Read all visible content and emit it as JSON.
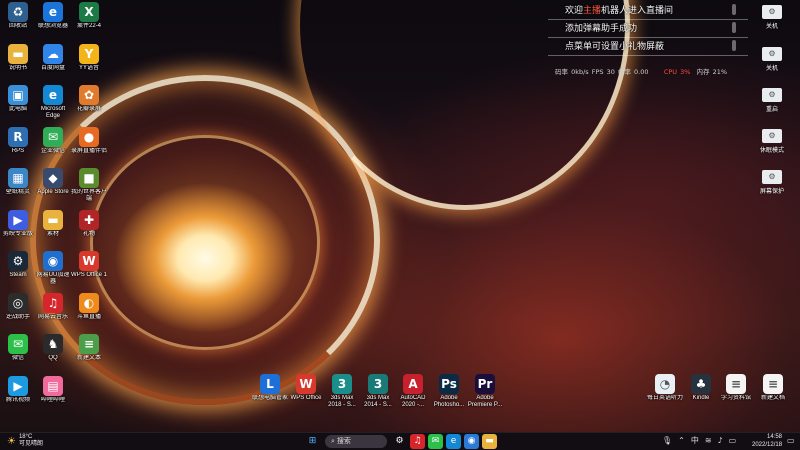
{
  "desktop_icons": [
    {
      "id": "recycle-bin",
      "label": "回收站",
      "icon": "recycle-icon",
      "glyph": "♻",
      "bg": "#2d5f8f"
    },
    {
      "id": "lenovo-browser",
      "label": "联想浏览器",
      "icon": "browser-icon",
      "glyph": "e",
      "bg": "#1a74d9"
    },
    {
      "id": "spreadsheet-file",
      "label": "案件22-4",
      "icon": "excel-file-icon",
      "glyph": "X",
      "bg": "#1d7a45"
    },
    {
      "id": "folder-a",
      "label": "说明书",
      "icon": "folder-icon",
      "glyph": "▬",
      "bg": "#e8b23c"
    },
    {
      "id": "baidu-netdisk",
      "label": "百度网盘",
      "icon": "cloud-icon",
      "glyph": "☁",
      "bg": "#2f86e8"
    },
    {
      "id": "yy-voice",
      "label": "YY语音",
      "icon": "yy-icon",
      "glyph": "Y",
      "bg": "#f2b418"
    },
    {
      "id": "this-pc",
      "label": "此电脑",
      "icon": "computer-icon",
      "glyph": "▣",
      "bg": "#3a8fd6"
    },
    {
      "id": "edge",
      "label": "Microsoft Edge",
      "icon": "edge-icon",
      "glyph": "e",
      "bg": "#1588d4"
    },
    {
      "id": "sakura-tool",
      "label": "花瓣录屏",
      "icon": "flower-app-icon",
      "glyph": "✿",
      "bg": "#e07a2d"
    },
    {
      "id": "rps",
      "label": "RPS",
      "icon": "rps-icon",
      "glyph": "R",
      "bg": "#2e6fb3"
    },
    {
      "id": "wechat-work",
      "label": "企业微信",
      "icon": "wecom-icon",
      "glyph": "✉",
      "bg": "#2fae57"
    },
    {
      "id": "record-tool",
      "label": "录屏直播伴侣",
      "icon": "camera-app-icon",
      "glyph": "●",
      "bg": "#e76a22"
    },
    {
      "id": "wallpaper-app",
      "label": "壁纸精灵",
      "icon": "wallpaper-icon",
      "glyph": "▦",
      "bg": "#3a86c7"
    },
    {
      "id": "apple-store",
      "label": "Apple Store",
      "icon": "apple-icon",
      "glyph": "◆",
      "bg": "#384a6e"
    },
    {
      "id": "minecraft",
      "label": "我的世界客户端",
      "icon": "grass-block-icon",
      "glyph": "■",
      "bg": "#5a8c2d"
    },
    {
      "id": "video-editor",
      "label": "剪映专业版",
      "icon": "video-editor-icon",
      "glyph": "▶",
      "bg": "#3f5de0"
    },
    {
      "id": "folder-b",
      "label": "素材",
      "icon": "folder-icon",
      "glyph": "▬",
      "bg": "#e8b23c"
    },
    {
      "id": "gift-app",
      "label": "礼物",
      "icon": "gift-icon",
      "glyph": "✚",
      "bg": "#b02626"
    },
    {
      "id": "steam",
      "label": "Steam",
      "icon": "steam-icon",
      "glyph": "⚙",
      "bg": "#1b2838"
    },
    {
      "id": "uu-accelerator",
      "label": "网易UU加速器",
      "icon": "accelerator-icon",
      "glyph": "◉",
      "bg": "#1f6fd1"
    },
    {
      "id": "wps-app",
      "label": "WPS Office 1",
      "icon": "wps-icon",
      "glyph": "W",
      "bg": "#d9382d"
    },
    {
      "id": "game-launcher",
      "label": "逆战助手",
      "icon": "game-icon",
      "glyph": "◎",
      "bg": "#2c2c2c"
    },
    {
      "id": "netease-music",
      "label": "网易云音乐",
      "icon": "music-icon",
      "glyph": "♫",
      "bg": "#d7262b"
    },
    {
      "id": "streaming-app",
      "label": "斗鱼直播",
      "icon": "fish-icon",
      "glyph": "◐",
      "bg": "#ef8b1b"
    },
    {
      "id": "wechat",
      "label": "微信",
      "icon": "wechat-icon",
      "glyph": "✉",
      "bg": "#2cbf4a"
    },
    {
      "id": "qq",
      "label": "QQ",
      "icon": "penguin-icon",
      "glyph": "♞",
      "bg": "#2a2a2a"
    },
    {
      "id": "text-file",
      "label": "新建文本",
      "icon": "text-file-icon",
      "glyph": "≡",
      "bg": "#4c9e4a"
    },
    {
      "id": "tencent-video",
      "label": "腾讯视频",
      "icon": "play-icon",
      "glyph": "▶",
      "bg": "#1e9ae0"
    },
    {
      "id": "bilibili-app",
      "label": "哔哩哔哩",
      "icon": "bilibili-icon",
      "glyph": "▤",
      "bg": "#f06a9c"
    }
  ],
  "bottom_icons": [
    {
      "id": "lenovo-manager",
      "label": "联想电脑管家",
      "icon": "lenovo-icon",
      "glyph": "L",
      "bg": "#1f6fd8"
    },
    {
      "id": "wps-office",
      "label": "WPS Office",
      "icon": "wps-icon",
      "glyph": "W",
      "bg": "#d9382d"
    },
    {
      "id": "3dsmax-2018",
      "label": "3ds Max 2018 - S...",
      "icon": "3dsmax-icon",
      "glyph": "3",
      "bg": "#1b8e8a"
    },
    {
      "id": "3dsmax-2014",
      "label": "3ds Max 2014 - S...",
      "icon": "3dsmax-icon",
      "glyph": "3",
      "bg": "#1a7a78"
    },
    {
      "id": "autocad",
      "label": "AutoCAD 2020 -...",
      "icon": "autocad-icon",
      "glyph": "A",
      "bg": "#c8202c"
    },
    {
      "id": "photoshop",
      "label": "Adobe Photosho...",
      "icon": "photoshop-icon",
      "glyph": "Ps",
      "bg": "#0b2a45"
    },
    {
      "id": "premiere",
      "label": "Adobe Premiere P...",
      "icon": "premiere-icon",
      "glyph": "Pr",
      "bg": "#1a0e3a"
    },
    {
      "id": "daily-tool",
      "label": "每日英语听力",
      "icon": "swirl-app-icon",
      "glyph": "◔",
      "bg": "#e8f0f6"
    },
    {
      "id": "kindle",
      "label": "Kindle",
      "icon": "kindle-icon",
      "glyph": "♣",
      "bg": "#26323d"
    },
    {
      "id": "study-doc",
      "label": "学习资料馆",
      "icon": "document-icon",
      "glyph": "≡",
      "bg": "#f4f4f4"
    },
    {
      "id": "new-doc",
      "label": "新建文档",
      "icon": "document-icon",
      "glyph": "≡",
      "bg": "#f4f4f4"
    }
  ],
  "live_panel": {
    "line1_prefix": "欢迎",
    "line1_accent": "主播",
    "line1_suffix": "机器人进入直播间",
    "line2": "添加弹幕助手成功",
    "line3": "点菜单可设置小礼物屏蔽",
    "stats_plain": "码率 0kb/s  FPS 30  帧率 0.00",
    "stats_hot": "CPU 3%",
    "stats_tail": "内存 21%"
  },
  "side_buttons": [
    {
      "id": "power-off",
      "label": "关机",
      "icon": "power-icon"
    },
    {
      "id": "shutdown-2",
      "label": "关机",
      "icon": "power-icon"
    },
    {
      "id": "restart",
      "label": "重启",
      "icon": "restart-icon"
    },
    {
      "id": "sleep",
      "label": "休眠模式",
      "icon": "sleep-icon"
    },
    {
      "id": "screen-protect",
      "label": "屏幕保护",
      "icon": "screen-icon"
    }
  ],
  "taskbar": {
    "weather_temp": "18°C",
    "weather_desc": "可见晴朗",
    "search_label": "搜索",
    "apps": [
      {
        "id": "tb-start",
        "glyph": "⊞",
        "bg": "transparent",
        "icon": "windows-start-icon"
      },
      {
        "id": "tb-settings",
        "glyph": "⚙",
        "bg": "transparent",
        "icon": "settings-icon"
      },
      {
        "id": "tb-netease",
        "glyph": "♫",
        "bg": "#d7262b",
        "icon": "music-icon"
      },
      {
        "id": "tb-wechat",
        "glyph": "✉",
        "bg": "#2cbf4a",
        "icon": "wechat-icon"
      },
      {
        "id": "tb-edge",
        "glyph": "e",
        "bg": "#1588d4",
        "icon": "edge-icon"
      },
      {
        "id": "tb-browser",
        "glyph": "◉",
        "bg": "#2a7ad6",
        "icon": "browser-icon"
      },
      {
        "id": "tb-files",
        "glyph": "▬",
        "bg": "#e8b23c",
        "icon": "folder-icon"
      }
    ],
    "tray_mic": "🎙",
    "tray_lang": "中",
    "tray_network": "≋",
    "tray_volume": "♪",
    "tray_battery": "▭",
    "clock_time": "14:58",
    "clock_date": "2022/12/18"
  }
}
